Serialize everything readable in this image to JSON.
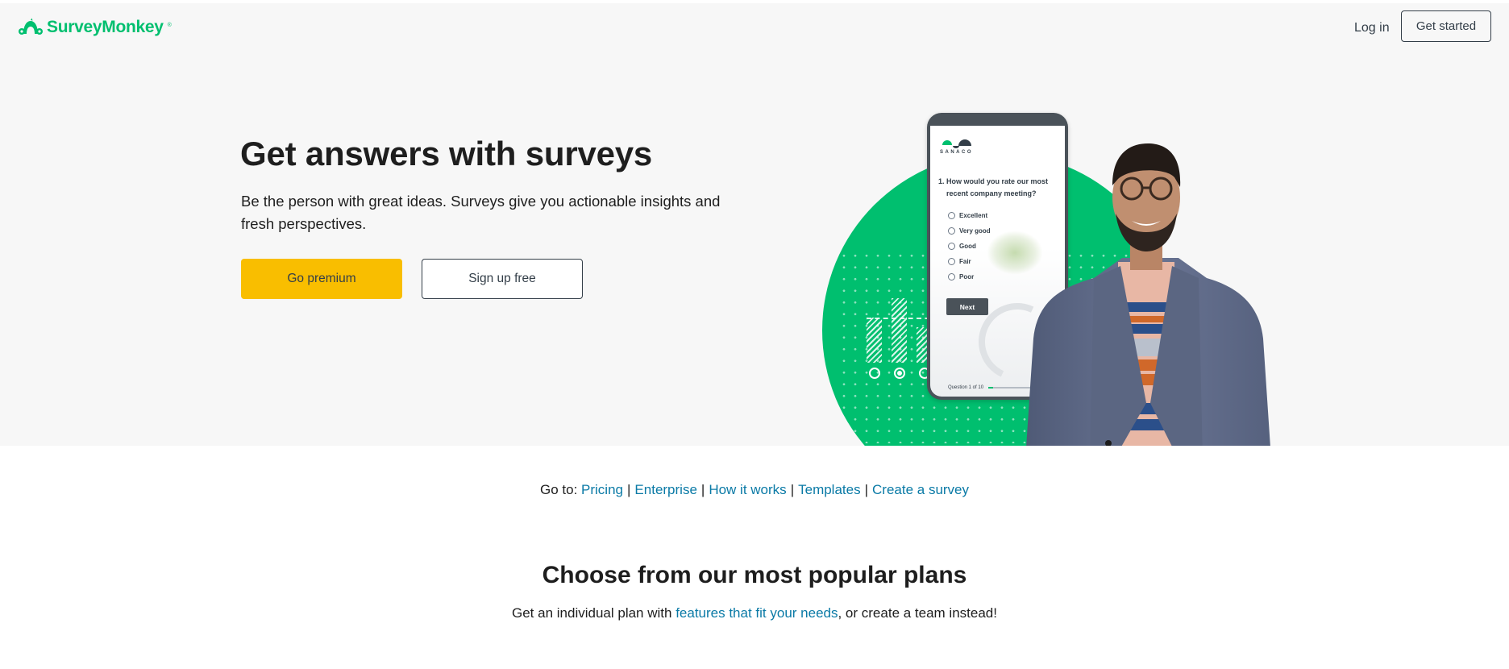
{
  "header": {
    "logo_text": "SurveyMonkey",
    "logo_reg": "®",
    "login_label": "Log in",
    "get_started_label": "Get started"
  },
  "hero": {
    "title": "Get answers with surveys",
    "subtitle": "Be the person with great ideas. Surveys give you actionable insights and fresh perspectives.",
    "premium_label": "Go premium",
    "signup_label": "Sign up free"
  },
  "phone_mockup": {
    "brand": "SANACO",
    "question_number": "1.",
    "question_line1": "How would you rate our most",
    "question_line2": "recent company meeting?",
    "options": [
      "Excellent",
      "Very good",
      "Good",
      "Fair",
      "Poor"
    ],
    "next_label": "Next",
    "progress_text": "Question 1 of 10",
    "progress_fraction": 0.1
  },
  "goto": {
    "prefix": "Go to:",
    "links": [
      "Pricing",
      "Enterprise",
      "How it works",
      "Templates",
      "Create a survey"
    ],
    "separator": "|"
  },
  "plans": {
    "title": "Choose from our most popular plans",
    "subtitle_before": "Get an individual plan with ",
    "subtitle_link": "features that fit your needs",
    "subtitle_after": ", or create a team instead!"
  },
  "colors": {
    "brand_green": "#00bf6f",
    "premium_yellow": "#f9be00",
    "link_blue": "#0a7aa6",
    "text_dark": "#333e48"
  }
}
